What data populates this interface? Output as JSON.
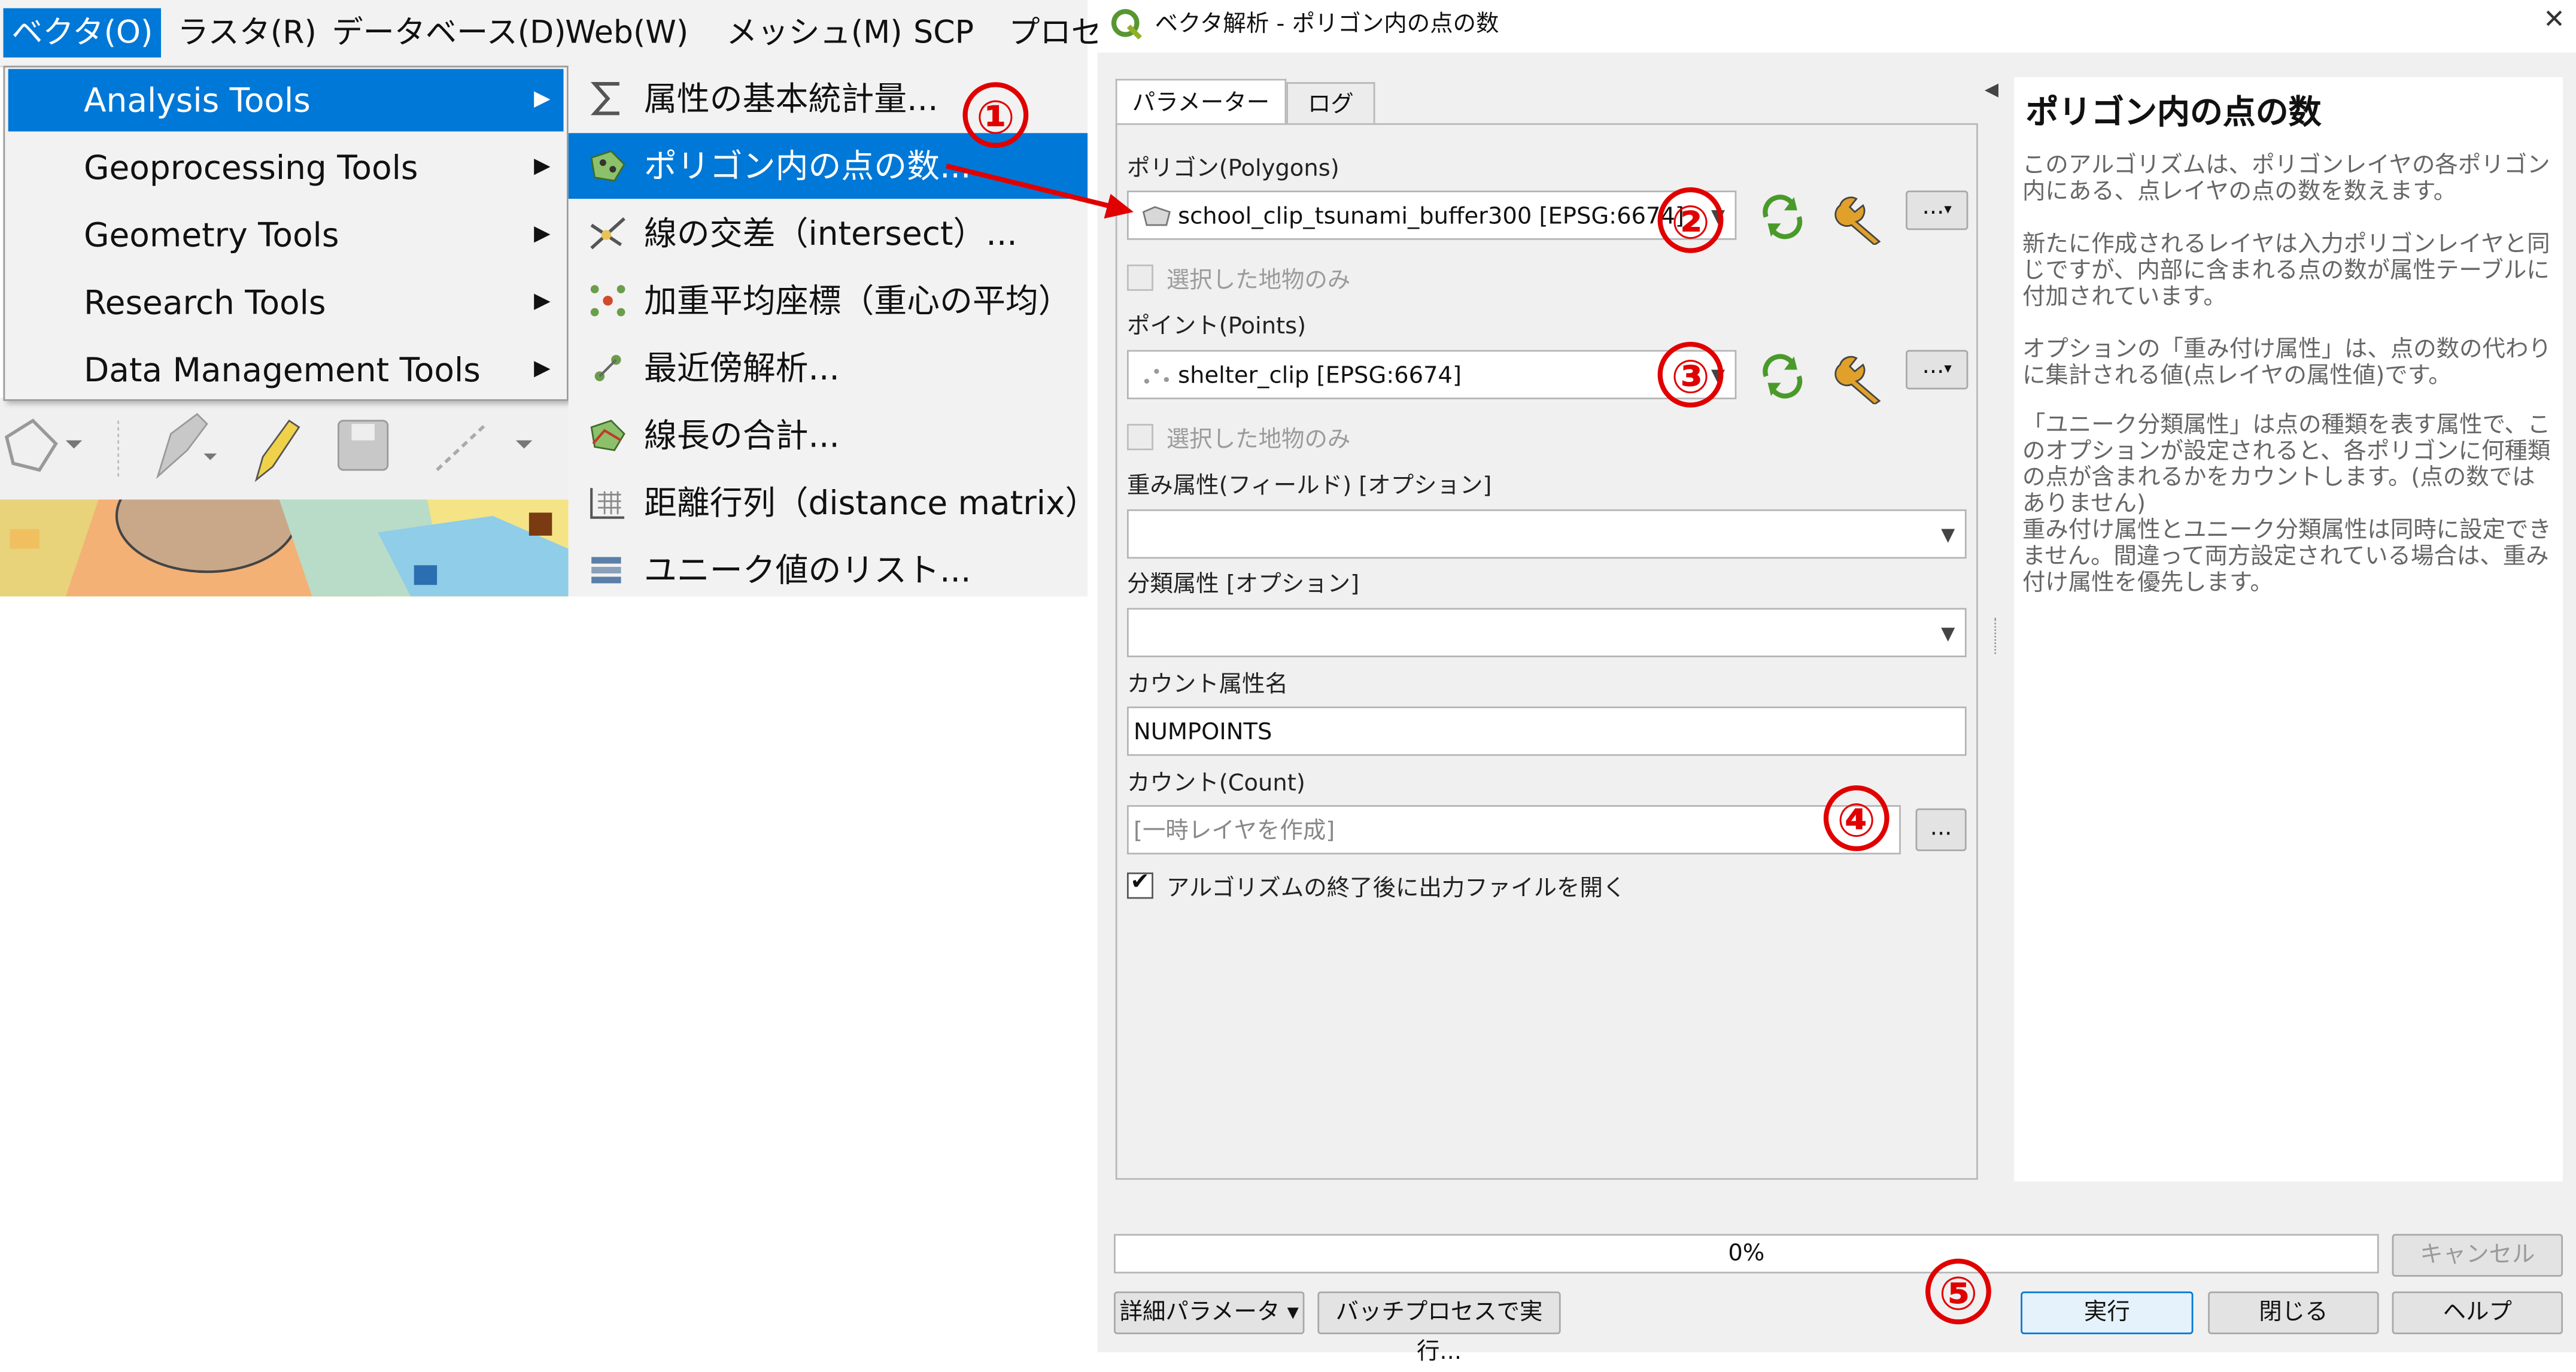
{
  "menubar": {
    "items": [
      "ベクタ(O)",
      "ラスタ(R)",
      "データベース(D)",
      "Web(W)",
      "メッシュ(M)",
      "SCP",
      "プロセ"
    ]
  },
  "vector_menu": {
    "items": [
      {
        "label": "Analysis Tools",
        "highlighted": true
      },
      {
        "label": "Geoprocessing Tools"
      },
      {
        "label": "Geometry Tools"
      },
      {
        "label": "Research Tools"
      },
      {
        "label": "Data Management Tools"
      }
    ],
    "submenu_arrow": "▶"
  },
  "analysis_submenu": {
    "items": [
      {
        "label": "属性の基本統計量...",
        "icon": "sigma-icon"
      },
      {
        "label": "ポリゴン内の点の数...",
        "icon": "points-in-polygon-icon",
        "highlighted": true
      },
      {
        "label": "線の交差（intersect）...",
        "icon": "line-intersection-icon"
      },
      {
        "label": "加重平均座標（重心の平均）",
        "icon": "mean-coordinates-icon"
      },
      {
        "label": "最近傍解析...",
        "icon": "nearest-neighbour-icon"
      },
      {
        "label": "線長の合計...",
        "icon": "sum-line-lengths-icon"
      },
      {
        "label": "距離行列（distance matrix）...",
        "icon": "distance-matrix-icon"
      },
      {
        "label": "ユニーク値のリスト...",
        "icon": "list-unique-values-icon"
      }
    ]
  },
  "annotations": {
    "n1": "①",
    "n2": "②",
    "n3": "③",
    "n4": "④",
    "n5": "⑤"
  },
  "dialog": {
    "title": "ベクタ解析 - ポリゴン内の点の数",
    "close": "✕",
    "collapse": "◀",
    "tabs": [
      "パラメーター",
      "ログ"
    ],
    "polygons_label": "ポリゴン(Polygons)",
    "polygons_value": "school_clip_tsunami_buffer300 [EPSG:6674]",
    "selected_only": "選択した地物のみ",
    "points_label": "ポイント(Points)",
    "points_value": "shelter_clip [EPSG:6674]",
    "weight_label": "重み属性(フィールド) [オプション]",
    "class_label": "分類属性 [オプション]",
    "count_field_label": "カウント属性名",
    "count_field_value": "NUMPOINTS",
    "count_label": "カウント(Count)",
    "count_placeholder": "[一時レイヤを作成]",
    "open_output": "アルゴリズムの終了後に出力ファイルを開く",
    "check_mark": "✔",
    "ellipsis": "...",
    "dropdown": "▼",
    "progress": "0%",
    "cancel": "キャンセル",
    "advanced": "詳細パラメータ ▾",
    "batch": "バッチプロセスで実行...",
    "run": "実行",
    "close_btn": "閉じる",
    "help_btn": "ヘルプ"
  },
  "help": {
    "title": "ポリゴン内の点の数",
    "paragraphs": [
      "このアルゴリズムは、ポリゴンレイヤの各ポリゴン内にある、点レイヤの点の数を数えます。",
      "新たに作成されるレイヤは入力ポリゴンレイヤと同じですが、内部に含まれる点の数が属性テーブルに付加されています。",
      "オプションの「重み付け属性」は、点の数の代わりに集計される値(点レイヤの属性値)です。",
      "「ユニーク分類属性」は点の種類を表す属性で、このオプションが設定されると、各ポリゴンに何種類の点が含まれるかをカウントします。(点の数ではありません)",
      "重み付け属性とユニーク分類属性は同時に設定できません。間違って両方設定されている場合は、重み付け属性を優先します。"
    ]
  }
}
